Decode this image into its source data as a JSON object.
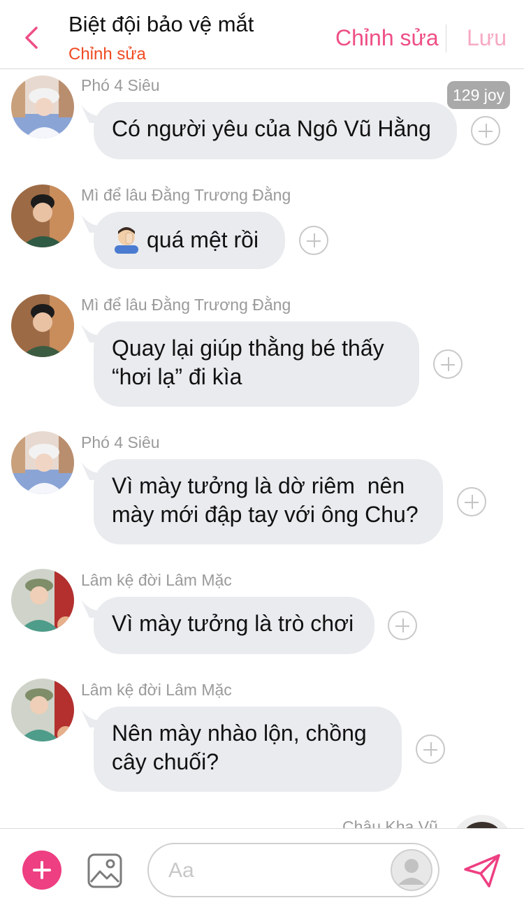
{
  "header": {
    "title": "Biệt đội bảo vệ mắt",
    "subtitle": "Chỉnh sửa",
    "edit_label": "Chỉnh sửa",
    "save_label": "Lưu"
  },
  "messages": [
    {
      "sender": "Phó 4 Siêu",
      "text": "Có người yêu của Ngô Vũ Hằng",
      "badge": "129 joy"
    },
    {
      "sender": "Mì để lâu Đằng Trương Đằng",
      "text": "quá mệt rồi",
      "emoji": "facepalm-emoji"
    },
    {
      "sender": "Mì để lâu Đằng Trương Đằng",
      "line1": "Quay lại giúp thằng bé thấy",
      "line2": "“hơi lạ” đi kìa"
    },
    {
      "sender": "Phó 4 Siêu",
      "line1": "Vì mày tưởng là dờ riêm  nên",
      "line2": "mày mới đập tay với ông Chu?"
    },
    {
      "sender": "Lâm kệ đời Lâm Mặc",
      "text": "Vì mày tưởng là trò chơi"
    },
    {
      "sender": "Lâm kệ đời Lâm Mặc",
      "line1": "Nên mày nhào lộn, chồng",
      "line2": "cây chuối?"
    },
    {
      "sender": "Châu Kha Vũ"
    }
  ],
  "composer": {
    "placeholder": "Aa"
  },
  "colors": {
    "accent": "#ee4f86",
    "subtitle": "#f04a23",
    "bubble": "#e9ebee",
    "sender_text": "#9a9a9a",
    "plus_button": "#ee3f82"
  },
  "icons": [
    "back-chevron-icon",
    "add-reaction-icon",
    "image-icon",
    "profile-icon",
    "send-icon",
    "plus-icon"
  ]
}
